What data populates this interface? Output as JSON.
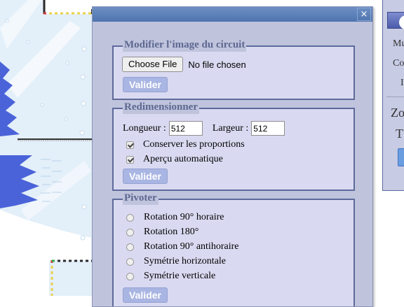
{
  "dialog": {
    "close_glyph": "×",
    "upload": {
      "legend": "Modifier l'image du circuit",
      "choose_label": "Choose File",
      "file_status": "No file chosen",
      "submit_label": "Valider"
    },
    "resize": {
      "legend": "Redimensionner",
      "length_label": "Longueur :",
      "length_value": "512",
      "width_label": "Largeur :",
      "width_value": "512",
      "keep_ratio_label": "Conserver les proportions",
      "keep_ratio_checked": true,
      "auto_preview_label": "Aperçu automatique",
      "auto_preview_checked": true,
      "submit_label": "Valider"
    },
    "rotate": {
      "legend": "Pivoter",
      "options": [
        "Rotation 90° horaire",
        "Rotation 180°",
        "Rotation 90° antihoraire",
        "Symétrie horizontale",
        "Symétrie verticale"
      ],
      "submit_label": "Valider"
    }
  },
  "side_panel": {
    "items": [
      "Mu",
      "Co",
      "I"
    ],
    "big_items": [
      "Zo",
      "T"
    ]
  },
  "colors": {
    "title_bar": "#4f74ae",
    "dialog_bg": "#bfc3dc",
    "group_bg": "#d9daf1",
    "legend_text": "#5d6891",
    "disabled_button": "#a9b5e2",
    "map_water": "#dfeef8",
    "map_track_blue": "#4a63d8"
  }
}
